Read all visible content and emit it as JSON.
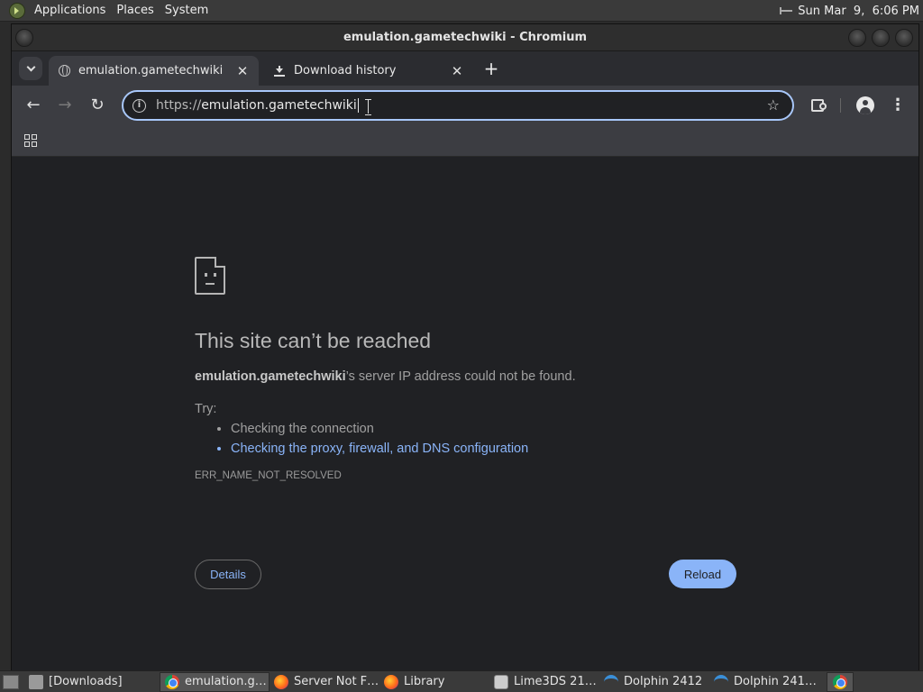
{
  "top_panel": {
    "menus": [
      "Applications",
      "Places",
      "System"
    ],
    "clock": "Sun Mar  9,  6:06 PM"
  },
  "window": {
    "title": "emulation.gametechwiki - Chromium"
  },
  "tabs": [
    {
      "label": "emulation.gametechwiki",
      "icon": "globe-icon",
      "active": true
    },
    {
      "label": "Download history",
      "icon": "download-icon",
      "active": false
    }
  ],
  "toolbar": {
    "url_scheme": "https://",
    "url_host": "emulation.gametechwiki"
  },
  "error_page": {
    "title": "This site can’t be reached",
    "host": "emulation.gametechwiki",
    "desc_rest": "’s server IP address could not be found.",
    "try_label": "Try:",
    "suggestions": [
      "Checking the connection",
      "Checking the proxy, firewall, and DNS configuration"
    ],
    "error_code": "ERR_NAME_NOT_RESOLVED",
    "details_label": "Details",
    "reload_label": "Reload",
    "link_color": "#8ab4f8"
  },
  "taskbar": {
    "items": [
      {
        "label": "[Downloads]",
        "icon": "folder-icon"
      },
      {
        "label": "emulation.g…",
        "icon": "chromium-icon",
        "active": true
      },
      {
        "label": "Server Not F…",
        "icon": "firefox-icon"
      },
      {
        "label": "Library",
        "icon": "firefox-icon"
      },
      {
        "label": "Lime3DS 21…",
        "icon": "terminal-icon"
      },
      {
        "label": "Dolphin 2412",
        "icon": "dolphin-icon"
      },
      {
        "label": "Dolphin 241…",
        "icon": "dolphin-icon"
      }
    ]
  }
}
